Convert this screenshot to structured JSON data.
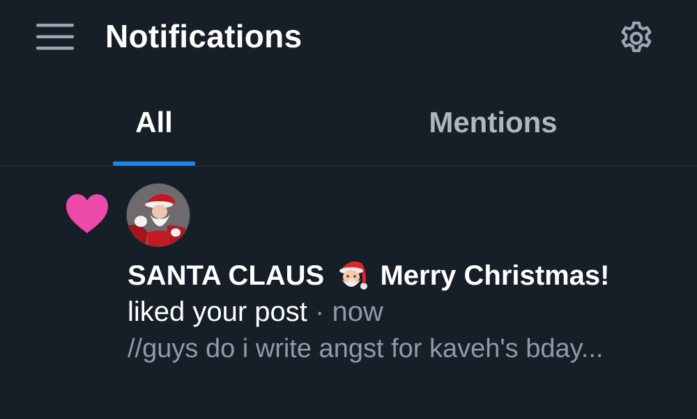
{
  "header": {
    "title": "Notifications"
  },
  "tabs": [
    {
      "label": "All",
      "active": true
    },
    {
      "label": "Mentions",
      "active": false
    }
  ],
  "notification": {
    "type_icon": "heart-icon",
    "author_name": "SANTA CLAUS",
    "author_suffix": "Merry Christmas!",
    "action": "liked your post",
    "separator": "·",
    "time": "now",
    "post_preview": "//guys do i write angst for kaveh's bday..."
  },
  "colors": {
    "background": "#161e27",
    "accent": "#1d87f0",
    "heart": "#ec4aa8",
    "muted_text": "#8e9ba8",
    "inactive_tab": "#aeb6bf"
  }
}
